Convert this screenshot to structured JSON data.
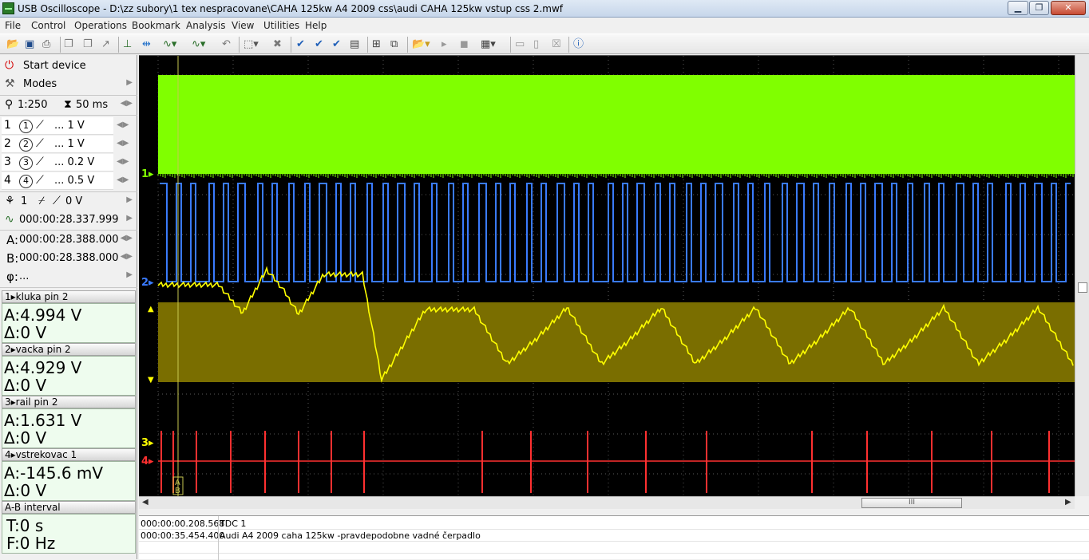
{
  "window": {
    "title": "USB Oscilloscope - D:\\zz subory\\1 tex nespracovane\\CAHA 125kw A4 2009 css\\audi CAHA 125kw vstup css 2.mwf",
    "min_label": "▁",
    "max_label": "❐",
    "close_label": "✕"
  },
  "menu": [
    "File",
    "Control",
    "Operations",
    "Bookmark",
    "Analysis",
    "View",
    "Utilities",
    "Help"
  ],
  "sidebar": {
    "start_device": "Start device",
    "modes": "Modes",
    "zoom": "1:250",
    "timebase": "50 ms",
    "channels": [
      {
        "num": "1",
        "circle": "1",
        "value": "... 1 V"
      },
      {
        "num": "2",
        "circle": "2",
        "value": "... 1 V"
      },
      {
        "num": "3",
        "circle": "3",
        "value": "... 0.2 V"
      },
      {
        "num": "4",
        "circle": "4",
        "value": "... 0.5 V"
      }
    ],
    "trigger": {
      "channel": "1",
      "level": "0 V"
    },
    "trigger_time": "000:00:28.337.999",
    "cursor_a": "000:00:28.388.000",
    "cursor_b": "000:00:28.388.000",
    "phi": "...",
    "labels": {
      "a": "A:",
      "b": "B:",
      "phi": "φ:"
    }
  },
  "measurements": [
    {
      "title": "kluka pin 2",
      "a": "A:4.994 V",
      "delta": "Δ:0 V"
    },
    {
      "title": "vacka pin 2",
      "a": "A:4.929 V",
      "delta": "Δ:0 V"
    },
    {
      "title": "rail pin 2",
      "a": "A:1.631 V",
      "delta": "Δ:0 V"
    },
    {
      "title": "vstrekovac 1",
      "a": "A:-145.6 mV",
      "delta": "Δ:0 V"
    }
  ],
  "ab_interval": {
    "title": "A-B interval",
    "t": "T:0 s",
    "f": "F:0 Hz"
  },
  "scope": {
    "channel_markers": [
      "1",
      "2",
      "3",
      "4"
    ],
    "cursor_labels": [
      "A",
      "B"
    ],
    "colors": {
      "ch1": "#80ff00",
      "ch2": "#3a7bff",
      "ch3": "#ffff00",
      "ch3_band": "#7a6e00",
      "ch4": "#ff3030",
      "grid": "#5a5a5a"
    }
  },
  "bookmarks": [
    {
      "time": "000:00:00.208.568",
      "text": "TDC 1"
    },
    {
      "time": "000:00:35.454.400",
      "text": "Audi A4 2009 caha 125kw -pravdepodobne vadné čerpadlo"
    }
  ],
  "hscroll_thumb": "III"
}
